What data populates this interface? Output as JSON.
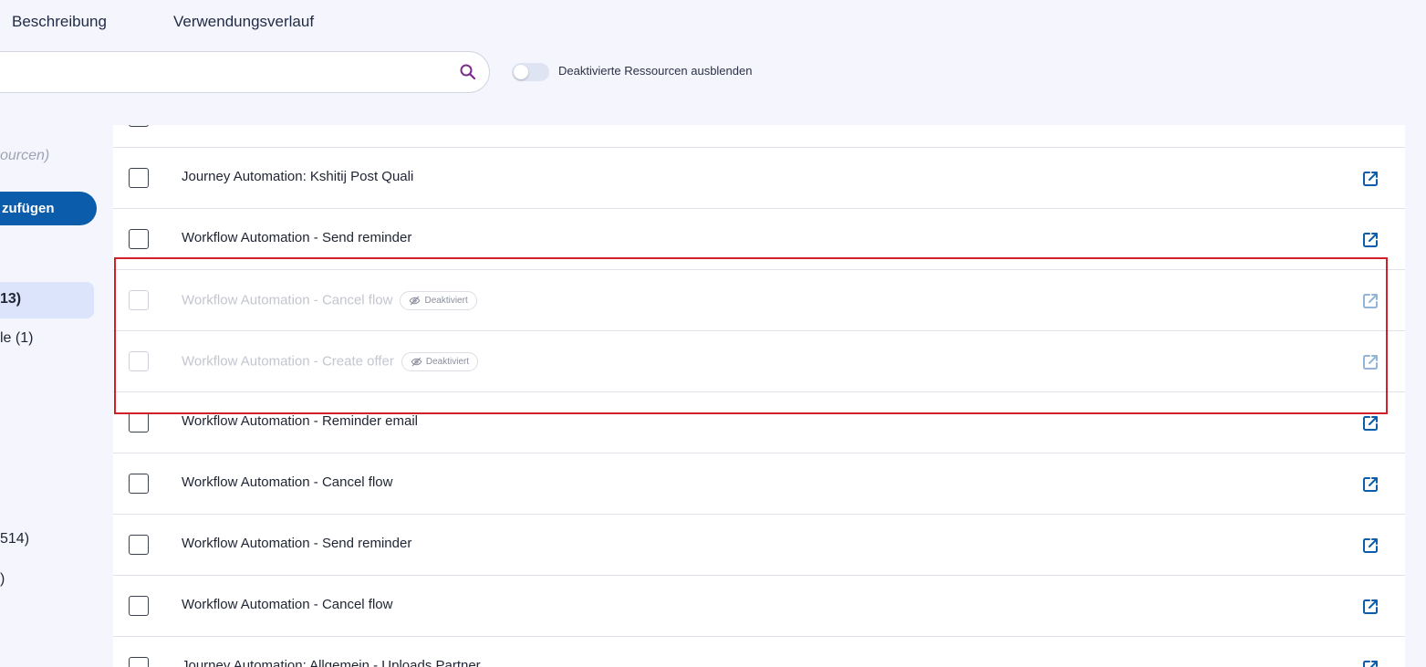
{
  "tabs": [
    {
      "label": "Beschreibung"
    },
    {
      "label": "Verwendungsverlauf"
    }
  ],
  "search": {
    "placeholder": ""
  },
  "toggle": {
    "label": "Deaktivierte Ressourcen ausblenden",
    "on": false
  },
  "sidebar": {
    "hint": "ourcen)",
    "add_button": "zufügen",
    "active_item": "13)",
    "item2": "le (1)",
    "item3": "514)",
    "item4": ")"
  },
  "colors": {
    "accent": "#0b5cab",
    "highlight": "#d0202a"
  },
  "rows": [
    {
      "title": "Journey Automation: Kshitij Post Quali",
      "disabled": false
    },
    {
      "title": "Workflow Automation - Send reminder",
      "disabled": false
    },
    {
      "title": "Workflow Automation - Cancel flow",
      "disabled": true,
      "badge": "Deaktiviert"
    },
    {
      "title": "Workflow Automation - Create offer",
      "disabled": true,
      "badge": "Deaktiviert"
    },
    {
      "title": "Workflow Automation - Reminder email",
      "disabled": false
    },
    {
      "title": "Workflow Automation - Cancel flow",
      "disabled": false
    },
    {
      "title": "Workflow Automation - Send reminder",
      "disabled": false
    },
    {
      "title": "Workflow Automation - Cancel flow",
      "disabled": false
    },
    {
      "title": "Journey Automation: Allgemein - Uploads Partner",
      "disabled": false
    }
  ]
}
